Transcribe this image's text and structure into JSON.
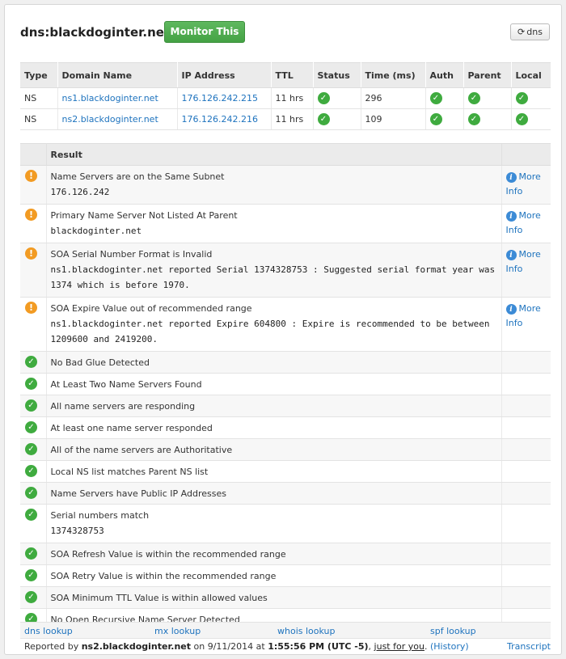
{
  "header": {
    "title": "dns:blackdoginter.net",
    "monitor_label": "Monitor This",
    "dns_button_label": "dns"
  },
  "ns_table": {
    "columns": [
      "Type",
      "Domain Name",
      "IP Address",
      "TTL",
      "Status",
      "Time (ms)",
      "Auth",
      "Parent",
      "Local"
    ],
    "rows": [
      {
        "type": "NS",
        "domain": "ns1.blackdoginter.net",
        "ip": "176.126.242.215",
        "ttl": "11 hrs",
        "time": "296"
      },
      {
        "type": "NS",
        "domain": "ns2.blackdoginter.net",
        "ip": "176.126.242.216",
        "ttl": "11 hrs",
        "time": "109"
      }
    ]
  },
  "results": {
    "header": "Result",
    "more_label": "More",
    "info_label": "Info",
    "rows": [
      {
        "status": "warning",
        "title": "Name Servers are on the Same Subnet",
        "detail": "176.126.242",
        "more_info": true
      },
      {
        "status": "warning",
        "title": "Primary Name Server Not Listed At Parent",
        "detail": "blackdoginter.net",
        "more_info": true
      },
      {
        "status": "warning",
        "title": "SOA Serial Number Format is Invalid",
        "detail": "ns1.blackdoginter.net reported Serial 1374328753 : Suggested serial format year was 1374 which is before 1970.",
        "more_info": true
      },
      {
        "status": "warning",
        "title": "SOA Expire Value out of recommended range",
        "detail": "ns1.blackdoginter.net reported Expire 604800 : Expire is recommended to be between 1209600 and 2419200.",
        "more_info": true
      },
      {
        "status": "ok",
        "title": "No Bad Glue Detected",
        "detail": "",
        "more_info": false
      },
      {
        "status": "ok",
        "title": "At Least Two Name Servers Found",
        "detail": "",
        "more_info": false
      },
      {
        "status": "ok",
        "title": "All name servers are responding",
        "detail": "",
        "more_info": false
      },
      {
        "status": "ok",
        "title": "At least one name server responded",
        "detail": "",
        "more_info": false
      },
      {
        "status": "ok",
        "title": "All of the name servers are Authoritative",
        "detail": "",
        "more_info": false
      },
      {
        "status": "ok",
        "title": "Local NS list matches Parent NS list",
        "detail": "",
        "more_info": false
      },
      {
        "status": "ok",
        "title": "Name Servers have Public IP Addresses",
        "detail": "",
        "more_info": false
      },
      {
        "status": "ok",
        "title": "Serial numbers match",
        "detail": "1374328753",
        "more_info": false
      },
      {
        "status": "ok",
        "title": "SOA Refresh Value is within the recommended range",
        "detail": "",
        "more_info": false
      },
      {
        "status": "ok",
        "title": "SOA Retry Value is within the recommended range",
        "detail": "",
        "more_info": false
      },
      {
        "status": "ok",
        "title": "SOA Minimum TTL Value is within allowed values",
        "detail": "",
        "more_info": false
      },
      {
        "status": "ok",
        "title": "No Open Recursive Name Server Detected",
        "detail": "",
        "more_info": false
      }
    ]
  },
  "footer": {
    "links": [
      "dns lookup",
      "mx lookup",
      "whois lookup",
      "spf lookup"
    ],
    "reported_by_prefix": "Reported by",
    "reporter": "ns2.blackdoginter.net",
    "on_text": "on 9/11/2014 at",
    "time": "1:55:56 PM (UTC -5)",
    "just_for_you": "just for you",
    "history": "(History)",
    "transcript": "Transcript"
  },
  "colors": {
    "ok": "#3fab3f",
    "warning": "#f29b23",
    "info": "#3c8bd6",
    "link": "#1e73be",
    "monitor_button": "#4cae4c"
  },
  "icons": {
    "ok": "check-circle-icon",
    "warning": "exclamation-circle-icon",
    "info": "info-circle-icon",
    "refresh": "refresh-icon"
  }
}
